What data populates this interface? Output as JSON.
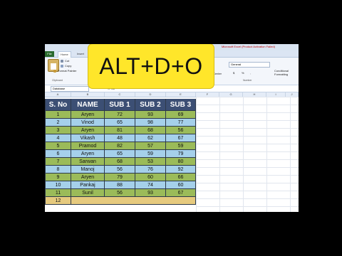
{
  "window": {
    "title": "Microsoft Excel (Product Activation Failed)"
  },
  "ribbon": {
    "tabs": [
      "File",
      "Home",
      "Insert"
    ],
    "clipboard": {
      "cut": "Cut",
      "copy": "Copy",
      "format_painter": "Format Painter",
      "group": "Clipboard"
    },
    "number": {
      "format": "General",
      "currency": "$",
      "percent": "%",
      "comma": ",",
      "group": "Number"
    },
    "alignment_right": "Center",
    "styles": {
      "conditional": "Conditional",
      "formatting": "Formatting"
    }
  },
  "formula_bar": {
    "name_box": "Database",
    "fx": "S. No"
  },
  "columns": [
    "A",
    "B",
    "C",
    "D",
    "E",
    "F",
    "G",
    "H",
    "I",
    "J"
  ],
  "overlay": {
    "shortcut": "ALT+D+O"
  },
  "table": {
    "headers": [
      "S. No",
      "NAME",
      "SUB 1",
      "SUB 2",
      "SUB 3"
    ],
    "rows": [
      [
        "1",
        "Aryen",
        "72",
        "93",
        "69"
      ],
      [
        "2",
        "Vinod",
        "65",
        "98",
        "77"
      ],
      [
        "3",
        "Aryen",
        "81",
        "68",
        "56"
      ],
      [
        "4",
        "Vikash",
        "48",
        "62",
        "67"
      ],
      [
        "5",
        "Pramod",
        "82",
        "57",
        "59"
      ],
      [
        "6",
        "Aryen",
        "65",
        "59",
        "79"
      ],
      [
        "7",
        "Sarwan",
        "68",
        "53",
        "80"
      ],
      [
        "8",
        "Manoj",
        "56",
        "76",
        "92"
      ],
      [
        "9",
        "Aryen",
        "79",
        "60",
        "66"
      ],
      [
        "10",
        "Pankaj",
        "88",
        "74",
        "60"
      ],
      [
        "11",
        "Sunil",
        "56",
        "93",
        "67"
      ],
      [
        "12",
        "",
        "",
        "",
        ""
      ]
    ]
  },
  "colors": {
    "header": "#3c4f74",
    "green_row": "#9bbb59",
    "blue_row": "#a5d0ea",
    "empty_row": "#e6ca7e",
    "badge": "#ffe62a"
  }
}
